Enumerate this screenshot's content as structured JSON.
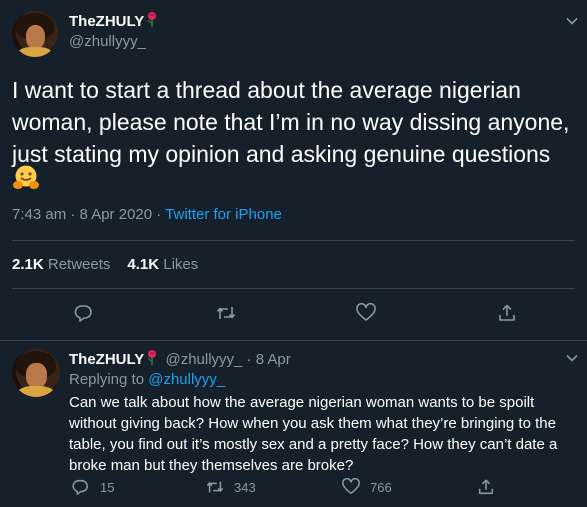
{
  "main_tweet": {
    "display_name": "TheZHULY",
    "handle": "@zhullyyy_",
    "text": "I want to start a thread about the average nigerian woman, please note that I’m in no way dissing anyone, just stating my opinion and asking genuine questions",
    "emoji": "hugging-face-emoji",
    "time": "7:43 am · 8 Apr 2020 · ",
    "source": "Twitter for iPhone",
    "retweets_count": "2.1K",
    "retweets_label": "Retweets",
    "likes_count": "4.1K",
    "likes_label": "Likes",
    "actions": [
      "reply-icon",
      "retweet-icon",
      "like-icon",
      "share-icon"
    ]
  },
  "reply_tweet": {
    "display_name": "TheZHULY",
    "handle_date": "@zhullyyy_ · 8 Apr",
    "replying_prefix": "Replying to ",
    "replying_to": "@zhullyyy_",
    "text": "Can we talk about how the average nigerian woman wants to be spoilt without giving back? How when you ask them what they’re bringing to the table, you find out it’s mostly sex and a pretty face? How they can’t date a broke man but they themselves are broke?",
    "reply_count": "15",
    "retweet_count": "343",
    "like_count": "766"
  },
  "colors": {
    "background": "#15202b",
    "text": "#ffffff",
    "secondary": "#8899a6",
    "link": "#1da1f2",
    "divider": "#38444d",
    "rose": "#e0245e"
  }
}
